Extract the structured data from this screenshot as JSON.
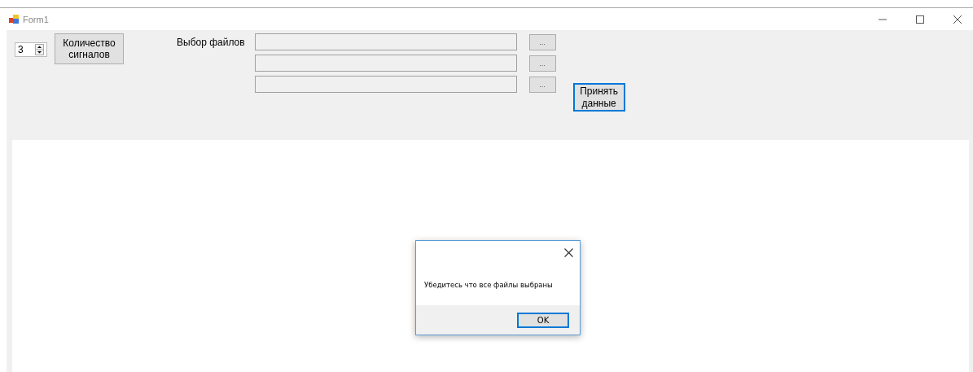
{
  "window": {
    "title": "Form1"
  },
  "signal_count": {
    "value": "3",
    "button": "Количество сигналов"
  },
  "files_label": "Выбор файлов",
  "files": [
    {
      "browse": "..."
    },
    {
      "browse": "..."
    },
    {
      "browse": "..."
    }
  ],
  "accept_button": {
    "label": "Принять данные",
    "focused": true
  },
  "dialog": {
    "message": "Убедитесь что все файлы выбраны",
    "ok": "OK"
  }
}
